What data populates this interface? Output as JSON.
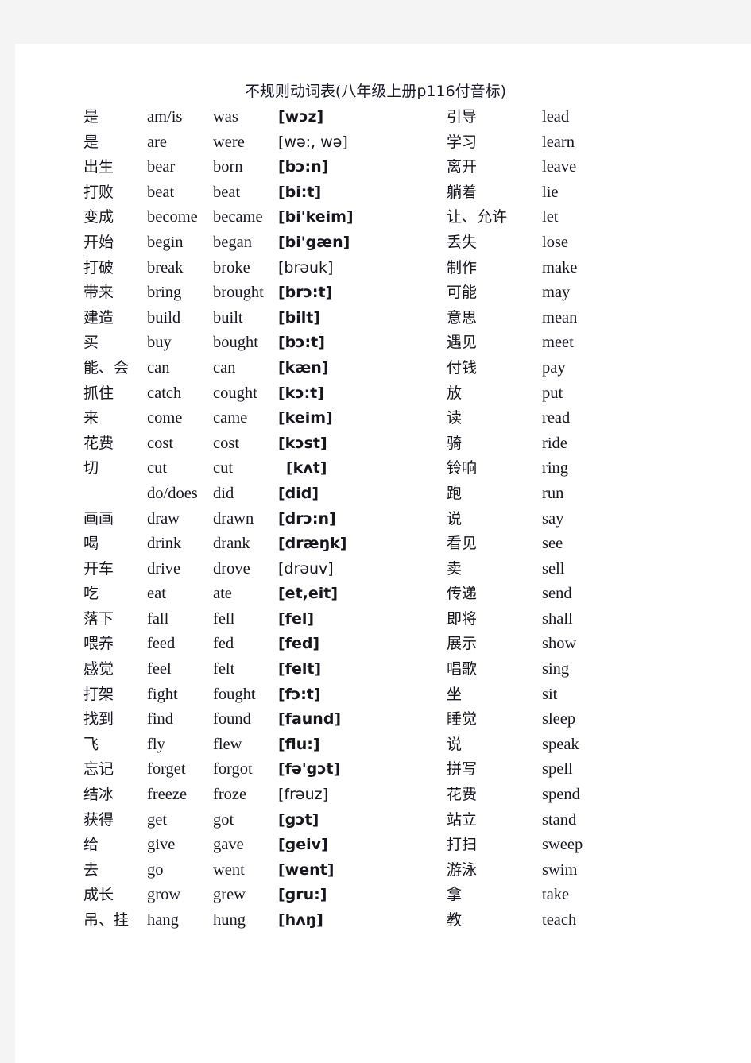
{
  "document": {
    "title": "不规则动词表(八年级上册p116付音标)"
  },
  "left_column": [
    {
      "cn": "是",
      "base": "am/is",
      "past": "was",
      "ipa": "[wɔz]",
      "bold": true
    },
    {
      "cn": "是",
      "base": "are",
      "past": "were",
      "ipa": "[wə:, wə]",
      "bold": false
    },
    {
      "cn": "出生",
      "base": "bear",
      "past": "born",
      "ipa": "[bɔ:n]",
      "bold": true
    },
    {
      "cn": "打败",
      "base": "beat",
      "past": "beat",
      "ipa": "[bi:t]",
      "bold": true
    },
    {
      "cn": "变成",
      "base": "become",
      "past": "became",
      "ipa": "[bi'keim]",
      "bold": true
    },
    {
      "cn": "开始",
      "base": "begin",
      "past": "began",
      "ipa": "[bi'gæn]",
      "bold": true
    },
    {
      "cn": "打破",
      "base": "break",
      "past": "broke",
      "ipa": "[brəuk]",
      "bold": false
    },
    {
      "cn": "带来",
      "base": "bring",
      "past": "brought",
      "ipa": "[brɔ:t]",
      "bold": true
    },
    {
      "cn": "建造",
      "base": "build",
      "past": "built",
      "ipa": "[bilt]",
      "bold": true
    },
    {
      "cn": "买",
      "base": "buy",
      "past": "bought",
      "ipa": "[bɔ:t]",
      "bold": true
    },
    {
      "cn": "能、会",
      "base": "can",
      "past": "can",
      "ipa": "[kæn]",
      "bold": true
    },
    {
      "cn": "抓住",
      "base": "catch",
      "past": "cought",
      "ipa": "[kɔ:t]",
      "bold": true
    },
    {
      "cn": "来",
      "base": "come",
      "past": "came",
      "ipa": "[keim]",
      "bold": true
    },
    {
      "cn": "花费",
      "base": "cost",
      "past": "cost",
      "ipa": "[kɔst]",
      "bold": true
    },
    {
      "cn": "切",
      "base": "cut",
      "past": "cut",
      "ipa": "[kʌt]",
      "bold": true,
      "indent": true
    },
    {
      "cn": "",
      "base": "do/does",
      "past": "did",
      "ipa": "[did]",
      "bold": true
    },
    {
      "cn": "画画",
      "base": "draw",
      "past": "drawn",
      "ipa": "[drɔ:n]",
      "bold": true
    },
    {
      "cn": "喝",
      "base": "drink",
      "past": "drank",
      "ipa": "[dræŋk]",
      "bold": true
    },
    {
      "cn": "开车",
      "base": "drive",
      "past": "drove",
      "ipa": "[drəuv]",
      "bold": false
    },
    {
      "cn": "吃",
      "base": "eat",
      "past": "ate",
      "ipa": "[et,eit]",
      "bold": true
    },
    {
      "cn": "落下",
      "base": "fall",
      "past": "fell",
      "ipa": "[fel]",
      "bold": true
    },
    {
      "cn": "喂养",
      "base": "feed",
      "past": "fed",
      "ipa": "[fed]",
      "bold": true
    },
    {
      "cn": "感觉",
      "base": "feel",
      "past": "felt",
      "ipa": "[felt]",
      "bold": true
    },
    {
      "cn": "打架",
      "base": "fight",
      "past": "fought",
      "ipa": "[fɔ:t]",
      "bold": true
    },
    {
      "cn": "找到",
      "base": "find",
      "past": "found",
      "ipa": "[faund]",
      "bold": true
    },
    {
      "cn": "飞",
      "base": "fly",
      "past": "flew",
      "ipa": "[flu:]",
      "bold": true
    },
    {
      "cn": "忘记",
      "base": "forget",
      "past": "forgot",
      "ipa": "[fə'gɔt]",
      "bold": true
    },
    {
      "cn": "结冰",
      "base": "freeze",
      "past": "froze",
      "ipa": "[frəuz]",
      "bold": false
    },
    {
      "cn": "获得",
      "base": "get",
      "past": "got",
      "ipa": "[gɔt]",
      "bold": true
    },
    {
      "cn": "给",
      "base": "give",
      "past": "gave",
      "ipa": "[geiv]",
      "bold": true
    },
    {
      "cn": "去",
      "base": "go",
      "past": "went",
      "ipa": "[went]",
      "bold": true
    },
    {
      "cn": "成长",
      "base": "grow",
      "past": "grew",
      "ipa": "[gru:]",
      "bold": true
    },
    {
      "cn": "吊、挂",
      "base": "hang",
      "past": "hung",
      "ipa": "[hʌŋ]",
      "bold": true
    }
  ],
  "right_column": [
    {
      "cn": "引导",
      "base": "lead"
    },
    {
      "cn": "学习",
      "base": "learn"
    },
    {
      "cn": "离开",
      "base": "leave"
    },
    {
      "cn": "躺着",
      "base": "lie"
    },
    {
      "cn": "让、允许",
      "base": "let"
    },
    {
      "cn": "丢失",
      "base": "lose"
    },
    {
      "cn": "制作",
      "base": "make"
    },
    {
      "cn": "可能",
      "base": "may"
    },
    {
      "cn": "意思",
      "base": "mean"
    },
    {
      "cn": "遇见",
      "base": "meet"
    },
    {
      "cn": "付钱",
      "base": "pay"
    },
    {
      "cn": "放",
      "base": "put"
    },
    {
      "cn": "读",
      "base": "read"
    },
    {
      "cn": "骑",
      "base": "ride"
    },
    {
      "cn": "铃响",
      "base": "ring"
    },
    {
      "cn": "跑",
      "base": "run"
    },
    {
      "cn": "说",
      "base": "say"
    },
    {
      "cn": "看见",
      "base": "see"
    },
    {
      "cn": "卖",
      "base": "sell"
    },
    {
      "cn": "传递",
      "base": "send"
    },
    {
      "cn": "即将",
      "base": "shall"
    },
    {
      "cn": "展示",
      "base": "show"
    },
    {
      "cn": "唱歌",
      "base": "sing"
    },
    {
      "cn": "坐",
      "base": "sit"
    },
    {
      "cn": "睡觉",
      "base": "sleep"
    },
    {
      "cn": "说",
      "base": "speak"
    },
    {
      "cn": "拼写",
      "base": "spell"
    },
    {
      "cn": "花费",
      "base": "spend"
    },
    {
      "cn": "站立",
      "base": "stand"
    },
    {
      "cn": "打扫",
      "base": "sweep"
    },
    {
      "cn": "游泳",
      "base": "swim"
    },
    {
      "cn": "拿",
      "base": "take"
    },
    {
      "cn": "教",
      "base": "teach"
    }
  ]
}
